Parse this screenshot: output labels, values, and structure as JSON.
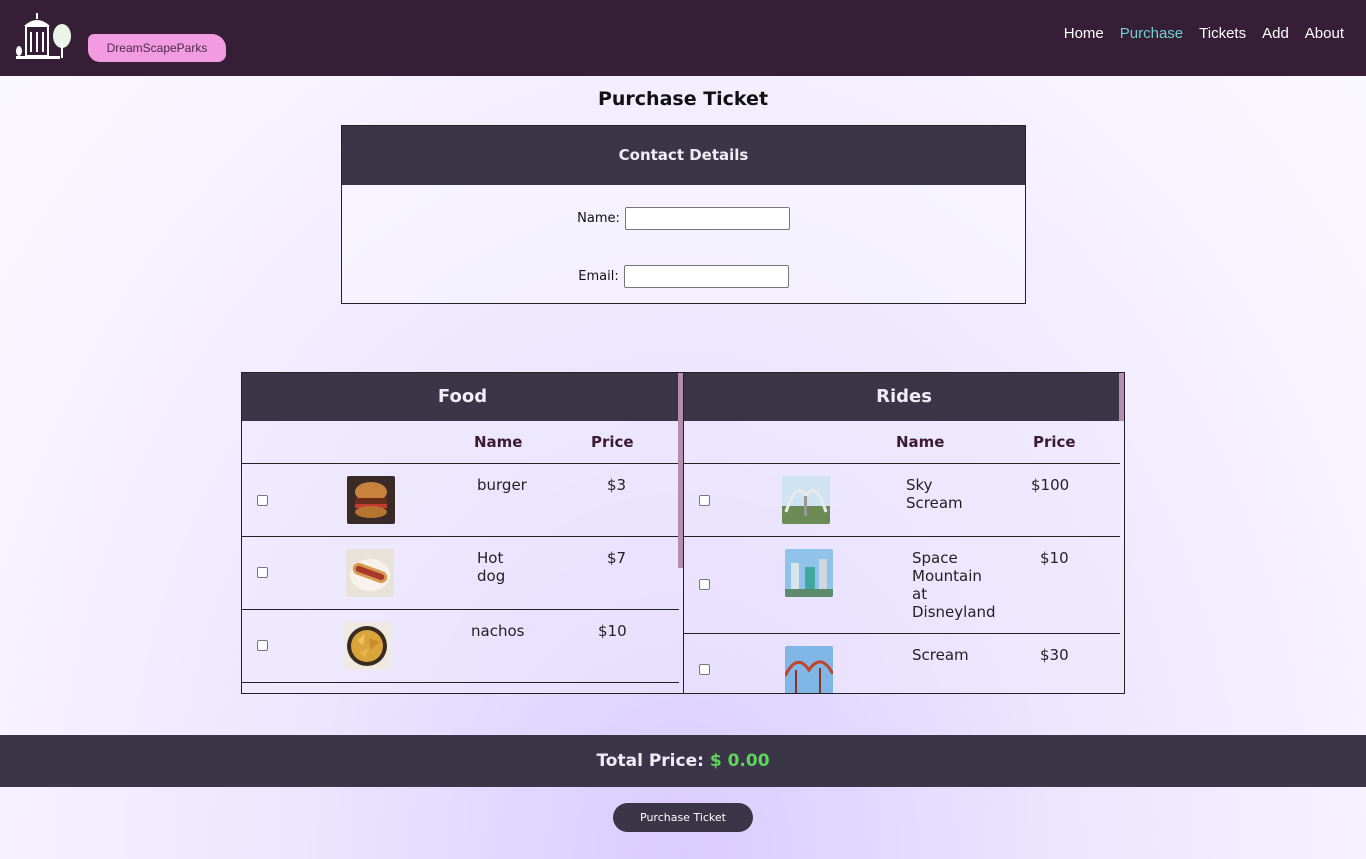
{
  "navbar": {
    "brand": "DreamScapeParks",
    "links": [
      {
        "label": "Home"
      },
      {
        "label": "Purchase"
      },
      {
        "label": "Tickets"
      },
      {
        "label": "Add"
      },
      {
        "label": "About"
      }
    ],
    "active": "Purchase"
  },
  "page": {
    "title": "Purchase Ticket"
  },
  "contact": {
    "title": "Contact Details",
    "name_label": "Name:",
    "name_value": "",
    "email_label": "Email:",
    "email_value": ""
  },
  "food": {
    "title": "Food",
    "col_name": "Name",
    "col_price": "Price",
    "items": [
      {
        "name": "burger",
        "price": "$3",
        "checked": false,
        "icon": "burger-image"
      },
      {
        "name": "Hot dog",
        "price": "$7",
        "checked": false,
        "icon": "hotdog-image"
      },
      {
        "name": "nachos",
        "price": "$10",
        "checked": false,
        "icon": "nachos-image"
      }
    ]
  },
  "rides": {
    "title": "Rides",
    "col_name": "Name",
    "col_price": "Price",
    "items": [
      {
        "name": "Sky Scream",
        "price": "$100",
        "checked": false,
        "icon": "ride-image"
      },
      {
        "name": "Space Mountain at Disneyland",
        "price": "$10",
        "checked": false,
        "icon": "ride-image"
      },
      {
        "name": "Scream",
        "price": "$30",
        "checked": false,
        "icon": "ride-image"
      }
    ]
  },
  "total": {
    "label": "Total Price:",
    "value": "$ 0.00"
  },
  "purchase_button": "Purchase Ticket",
  "colors": {
    "navbar": "#351e36",
    "nav_active": "#6fd3cf",
    "panel_header": "#3a3648",
    "total_amount": "#5ed65a",
    "brand_badge": "#f39be0"
  }
}
